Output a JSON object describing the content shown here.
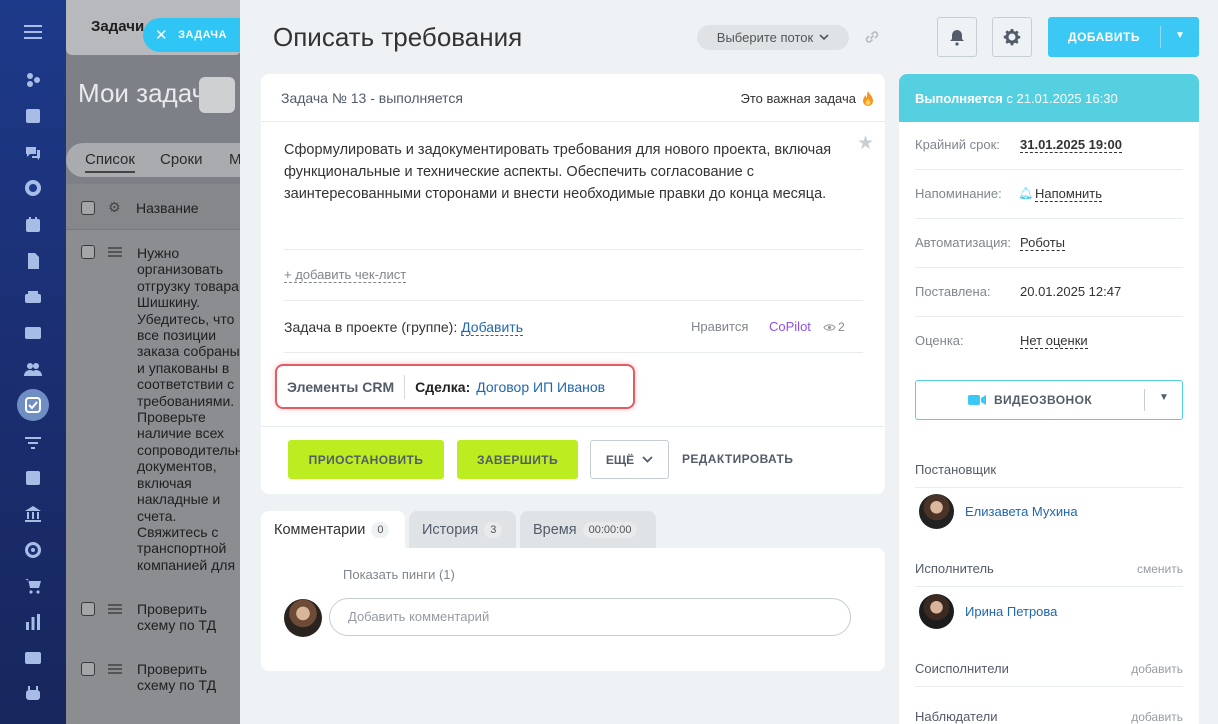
{
  "background": {
    "tab_label": "Задачи",
    "page_title": "Мои задачи",
    "view_tabs": [
      "Список",
      "Сроки",
      "М"
    ],
    "column_name": "Название",
    "rows": [
      {
        "text": "Нужно организовать отгрузку товара Шишкину. Убедитесь, что все позиции заказа собраны и упакованы в соответствии с требованиями. Проверьте наличие всех сопроводительных документов, включая накладные и счета. Свяжитесь с транспортной компанией для"
      },
      {
        "text": "Проверить схему по ТД"
      },
      {
        "text": "Проверить схему по ТД"
      }
    ]
  },
  "chip": {
    "label": "ЗАДАЧА"
  },
  "task": {
    "title": "Описать требования",
    "flow_placeholder": "Выберите поток",
    "add_label": "ДОБАВИТЬ",
    "header_text": "Задача № 13 - выполняется",
    "important_label": "Это важная задача",
    "description": "Сформулировать и задокументировать требования для нового проекта, включая функциональные и технические аспекты. Обеспечить согласование с заинтересованными сторонами и внести необходимые правки до конца месяца.",
    "checklist_label": "+ добавить чек-лист",
    "project_label": "Задача в проекте (группе):",
    "project_add": "Добавить",
    "likes_label": "Нравится",
    "copilot_label": "CoPilot",
    "views_count": "2",
    "crm": {
      "label": "Элементы CRM",
      "deal_label": "Сделка:",
      "deal_value": "Договор ИП Иванов"
    },
    "buttons": {
      "pause": "ПРИОСТАНОВИТЬ",
      "finish": "ЗАВЕРШИТЬ",
      "more": "ЕЩЁ",
      "edit": "РЕДАКТИРОВАТЬ"
    }
  },
  "comments": {
    "tabs": [
      {
        "label": "Комментарии",
        "count": "0"
      },
      {
        "label": "История",
        "count": "3"
      },
      {
        "label": "Время",
        "count": "00:00:00"
      }
    ],
    "show_pings": "Показать пинги (1)",
    "input_placeholder": "Добавить комментарий"
  },
  "sidebar": {
    "status_label": "Выполняется",
    "status_since": "с 21.01.2025 16:30",
    "rows": [
      {
        "key": "Крайний срок:",
        "value": "31.01.2025 19:00"
      },
      {
        "key": "Напоминание:",
        "value": "Напомнить"
      },
      {
        "key": "Автоматизация:",
        "value": "Роботы"
      },
      {
        "key": "Поставлена:",
        "value": "20.01.2025 12:47"
      },
      {
        "key": "Оценка:",
        "value": "Нет оценки"
      }
    ],
    "videocall_label": "ВИДЕОЗВОНОК",
    "creator_label": "Постановщик",
    "creator_name": "Елизавета Мухина",
    "assignee_label": "Исполнитель",
    "assignee_change": "сменить",
    "assignee_name": "Ирина Петрова",
    "coexec_label": "Соисполнители",
    "coexec_add": "добавить",
    "observers_label": "Наблюдатели",
    "observers_add": "добавить"
  },
  "colors": {
    "accent": "#3bc8f5",
    "status": "#55d0e0",
    "action_green": "#bbed21",
    "crm_highlight": "#e65a62",
    "copilot": "#8e52ec",
    "link": "#2067b0"
  }
}
